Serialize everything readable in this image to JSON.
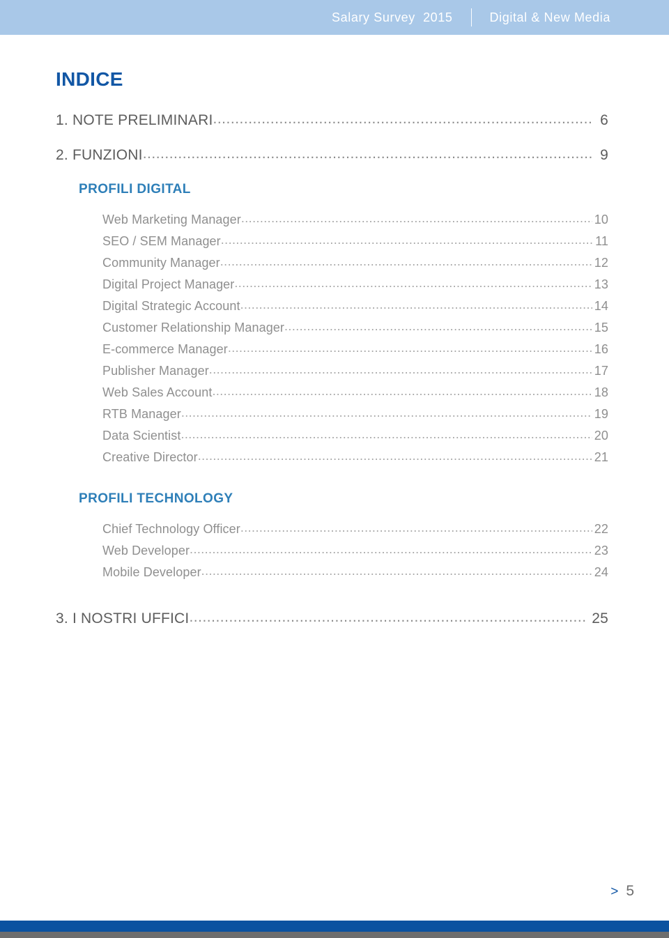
{
  "header": {
    "left_text": "Salary Survey  2015",
    "right_text": "Digital & New Media",
    "band_color": "#a9c8e8",
    "text_color": "#ffffff"
  },
  "title": "INDICE",
  "colors": {
    "indice_blue": "#1257a5",
    "section_blue": "#2e7fb8",
    "main_gray": "#5d5d5d",
    "sub_gray": "#8f8f8f",
    "footer_blue": "#0b52a0",
    "footer_gray": "#6e6e6e"
  },
  "toc": {
    "main_items": [
      {
        "label": "1. NOTE PRELIMINARI",
        "page": "6"
      },
      {
        "label": "2. FUNZIONI",
        "page": "9"
      }
    ],
    "final_item": {
      "label": "3. I NOSTRI UFFICI",
      "page": "25"
    },
    "sections": [
      {
        "heading": "PROFILI DIGITAL",
        "entries": [
          {
            "label": "Web Marketing Manager",
            "page": "10"
          },
          {
            "label": "SEO / SEM Manager",
            "page": "11"
          },
          {
            "label": "Community Manager",
            "page": "12"
          },
          {
            "label": "Digital Project Manager",
            "page": "13"
          },
          {
            "label": "Digital Strategic Account",
            "page": "14"
          },
          {
            "label": "Customer Relationship Manager",
            "page": "15"
          },
          {
            "label": "E-commerce Manager",
            "page": "16"
          },
          {
            "label": "Publisher Manager",
            "page": "17"
          },
          {
            "label": "Web Sales Account",
            "page": "18"
          },
          {
            "label": "RTB Manager",
            "page": "19"
          },
          {
            "label": "Data Scientist",
            "page": "20"
          },
          {
            "label": "Creative Director",
            "page": "21"
          }
        ]
      },
      {
        "heading": "PROFILI TECHNOLOGY",
        "entries": [
          {
            "label": "Chief Technology Officer",
            "page": "22"
          },
          {
            "label": "Web Developer",
            "page": "23"
          },
          {
            "label": "Mobile Developer",
            "page": "24"
          }
        ]
      }
    ]
  },
  "footer": {
    "arrow": ">",
    "page_number": "5"
  }
}
